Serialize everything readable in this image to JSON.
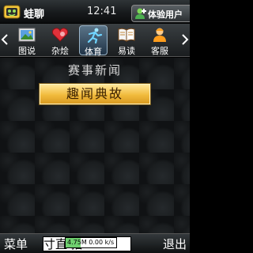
{
  "status_bar": {
    "app_name": "蛙聊",
    "time": "12:41",
    "user_button": "体验用户",
    "app_icon": "frog-logo-icon",
    "user_icon": "user-add-icon"
  },
  "tabs": [
    {
      "label": "图说",
      "icon": "picture-icon",
      "active": false
    },
    {
      "label": "杂烩",
      "icon": "heart-icon",
      "active": false
    },
    {
      "label": "体育",
      "icon": "sports-runner-icon",
      "active": true
    },
    {
      "label": "易读",
      "icon": "book-icon",
      "active": false
    },
    {
      "label": "客服",
      "icon": "customer-service-icon",
      "active": false
    }
  ],
  "main": {
    "section_title": "赛事新闻",
    "featured_item": "趣闻典故"
  },
  "softkeys": {
    "left": "菜单",
    "right": "退出",
    "ticker_text": "寸直 播"
  },
  "network_meter": {
    "text": "4.75M 0.00 k/s",
    "fill_percent": 30,
    "color": "#6fd06f"
  },
  "colors": {
    "accent_gold": "#f1bb3d",
    "active_tab": "#5a7488"
  }
}
